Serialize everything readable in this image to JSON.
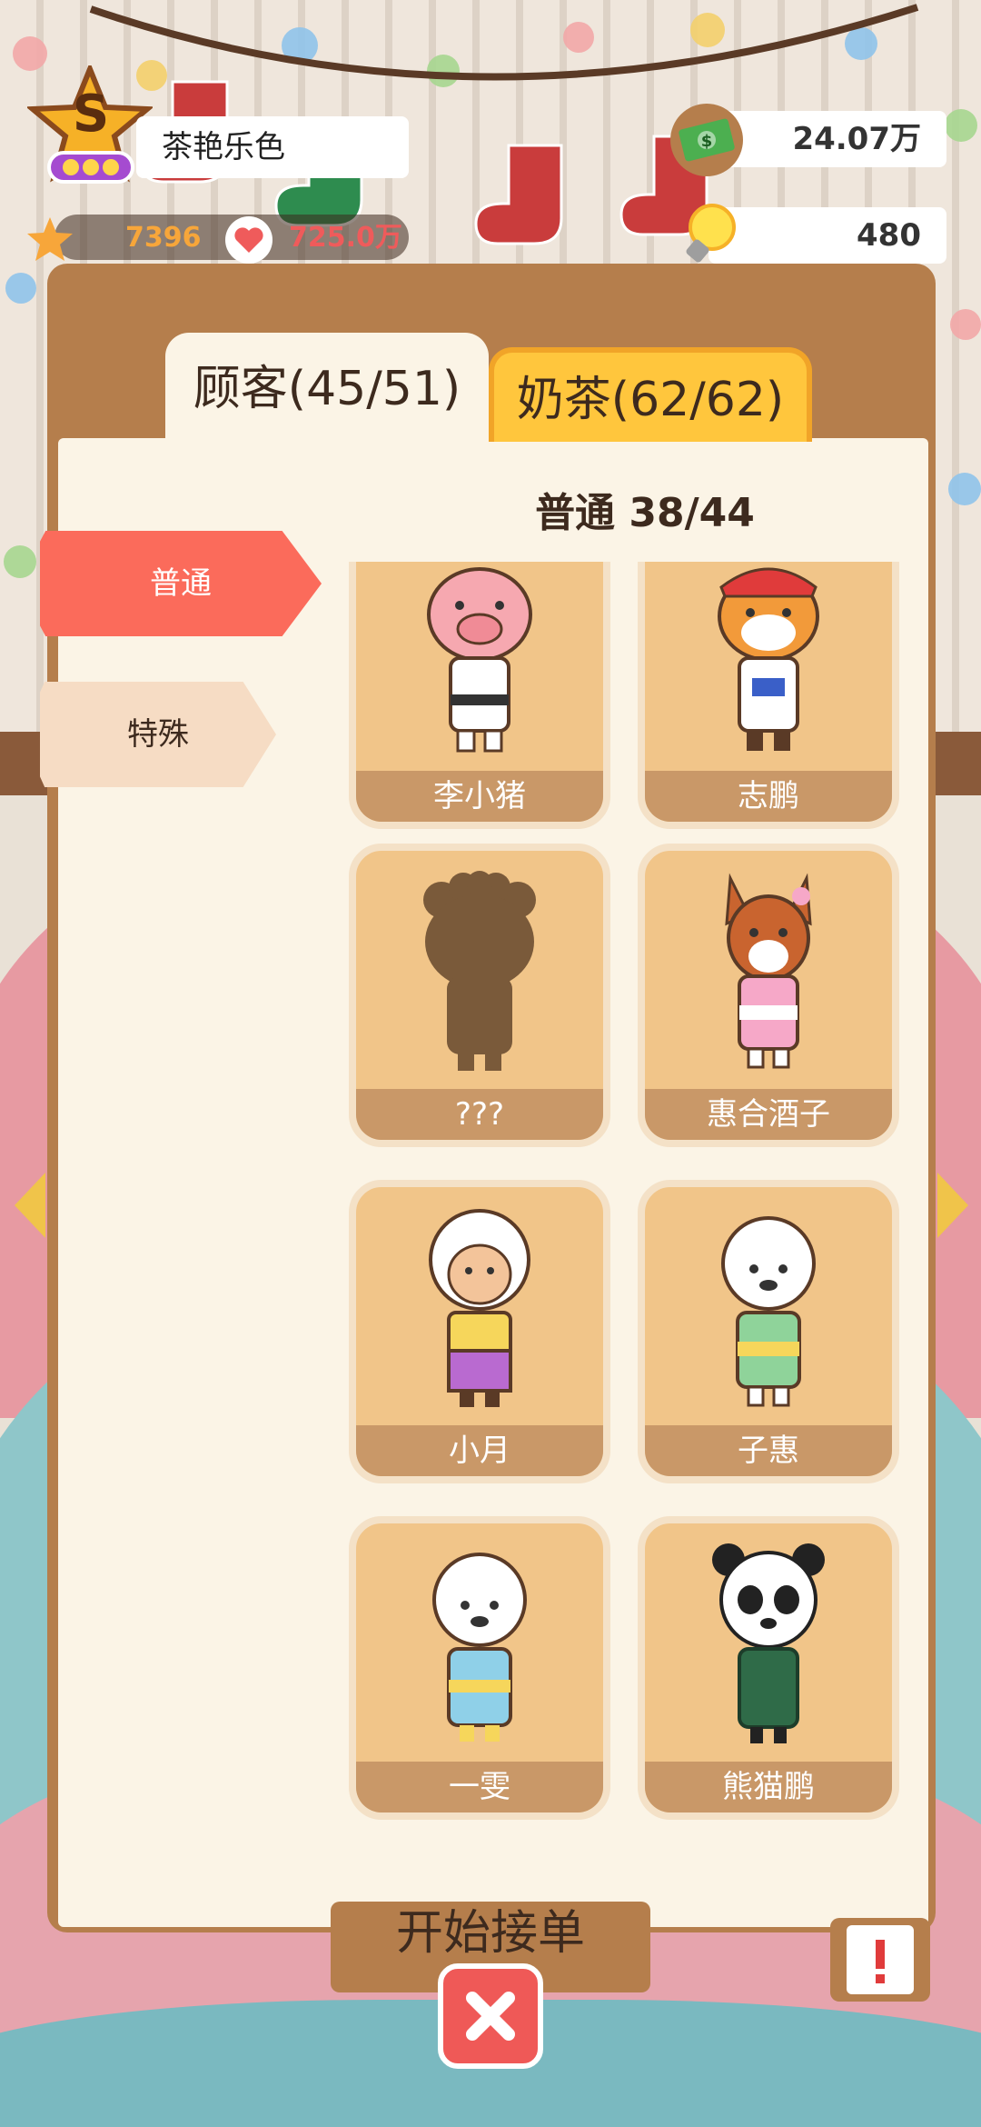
{
  "player": {
    "rank_letter": "S",
    "name": "茶艳乐色",
    "stars": "7396",
    "popularity": "725.0万"
  },
  "currency": {
    "money": "24.07万",
    "ideas": "480"
  },
  "tabs": [
    {
      "label": "顾客(45/51)",
      "active": true
    },
    {
      "label": "奶茶(62/62)",
      "active": false
    }
  ],
  "section_title": "普通 38/44",
  "categories": [
    {
      "label": "普通",
      "active": true
    },
    {
      "label": "特殊",
      "active": false
    }
  ],
  "customers": [
    {
      "name": "李小猪",
      "icon": "pig-judo-icon"
    },
    {
      "name": "志鹏",
      "icon": "tiger-racer-icon"
    },
    {
      "name": "???",
      "icon": "locked-silhouette-icon"
    },
    {
      "name": "惠合酒子",
      "icon": "deer-kimono-icon"
    },
    {
      "name": "小月",
      "icon": "sheep-purple-kimono-icon"
    },
    {
      "name": "子惠",
      "icon": "alpaca-green-kimono-icon"
    },
    {
      "name": "一雯",
      "icon": "goat-blue-kimono-icon"
    },
    {
      "name": "熊猫鹏",
      "icon": "panda-qipao-icon"
    }
  ],
  "start_button_label": "开始接单",
  "colors": {
    "accent_red": "#fb6b5b",
    "tab_yellow": "#ffc63d",
    "panel_brown": "#b57e4c",
    "card_bg": "#f1c589"
  }
}
